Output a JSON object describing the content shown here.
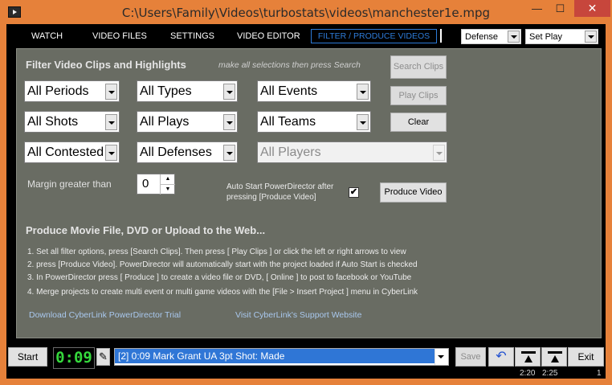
{
  "window": {
    "title": "C:\\Users\\Family\\Videos\\turbostats\\videos\\manchester1e.mpg",
    "minimize": "—",
    "maximize": "☐",
    "close": "✕"
  },
  "menu": {
    "watch": "WATCH",
    "video_files": "VIDEO FILES",
    "settings": "SETTINGS",
    "video_editor": "VIDEO EDITOR",
    "filter": "FILTER / PRODUCE VIDEOS",
    "team_select": "Defense",
    "mode_select": "Set Play"
  },
  "filter": {
    "heading": "Filter Video Clips and Highlights",
    "hint": "make all selections then press Search",
    "periods": "All Periods",
    "types": "All Types",
    "events": "All Events",
    "shots": "All Shots",
    "plays": "All Plays",
    "teams": "All Teams",
    "contested": "All Contested",
    "defenses": "All Defenses",
    "players": "All Players",
    "search_btn": "Search Clips",
    "play_btn": "Play Clips",
    "clear_btn": "Clear",
    "margin_label": "Margin greater than",
    "margin_value": "0",
    "autostart_label_1": "Auto Start PowerDirector after",
    "autostart_label_2": "pressing  [Produce Video]",
    "autostart_checked": true,
    "produce_btn": "Produce Video"
  },
  "produce": {
    "heading": "Produce Movie File, DVD or Upload to the Web...",
    "steps": [
      "1. Set all filter options, press [Search Clips].  Then press [ Play Clips ] or click the left or right arrows to view",
      "2. press [Produce Video]. PowerDirector will automatically start with the project loaded if Auto Start is checked",
      "3. In PowerDirector press [ Produce ] to create a video file or DVD, [ Online ] to  post to facebook or YouTube",
      "4. Merge projects to create multi event or multi game videos with the [File > Insert Project ] menu in CyberLink"
    ],
    "link_download": "Download CyberLink PowerDirector Trial",
    "link_support": "Visit CyberLink's Support Website"
  },
  "bottom": {
    "start_btn": "Start",
    "timer": "0:09",
    "clip": "[2]  0:09 Mark Grant UA 3pt Shot: Made",
    "save_btn": "Save",
    "exit_btn": "Exit",
    "time1": "2:20",
    "time2": "2:25",
    "count": "1"
  },
  "colors": {
    "frame": "#e6813a",
    "panel": "#696c63",
    "accent": "#2d7bd8",
    "timer": "#35d83c"
  },
  "icons": {
    "app": "video-app-icon",
    "edit": "pencil-icon",
    "undo": "undo-arrow-icon",
    "mark_in": "bracket-mark-in-icon",
    "mark_out": "bracket-mark-out-icon"
  }
}
